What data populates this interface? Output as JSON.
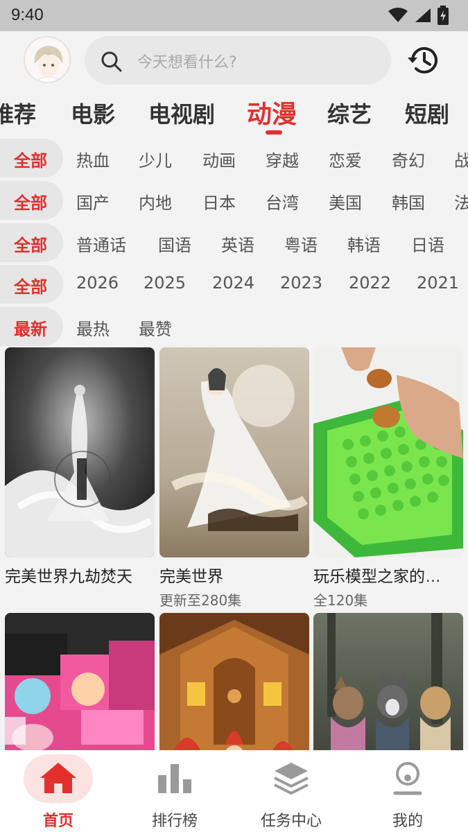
{
  "status_bar": {
    "time": "9:40",
    "icons": [
      "wifi-icon",
      "signal-icon",
      "battery-charging-icon"
    ]
  },
  "header": {
    "avatar": "user-avatar",
    "search_placeholder": "今天想看什么?",
    "history_icon": "history-icon"
  },
  "category_tabs": [
    "推荐",
    "电影",
    "电视剧",
    "动漫",
    "综艺",
    "短剧"
  ],
  "active_category": "动漫",
  "accent_color": "#e3302c",
  "filters": {
    "genre": {
      "active": "全部",
      "options": [
        "热血",
        "少儿",
        "动画",
        "穿越",
        "恋爱",
        "奇幻",
        "战"
      ]
    },
    "region": {
      "active": "全部",
      "options": [
        "国产",
        "内地",
        "日本",
        "台湾",
        "美国",
        "韩国",
        "法"
      ]
    },
    "language": {
      "active": "全部",
      "options": [
        "普通话",
        "国语",
        "英语",
        "粤语",
        "韩语",
        "日语"
      ]
    },
    "year": {
      "active": "全部",
      "options": [
        "2026",
        "2025",
        "2024",
        "2023",
        "2022",
        "2021"
      ]
    },
    "sort": {
      "active": "最新",
      "options": [
        "最热",
        "最赞"
      ]
    }
  },
  "items": [
    {
      "title": "完美世界九劫焚天",
      "subtitle": ""
    },
    {
      "title": "完美世界",
      "subtitle": "更新至280集"
    },
    {
      "title": "玩乐模型之家的…",
      "subtitle": "全120集"
    },
    {
      "title": "",
      "subtitle": ""
    },
    {
      "title": "",
      "subtitle": ""
    },
    {
      "title": "",
      "subtitle": ""
    }
  ],
  "bottom_nav": [
    {
      "label": "首页",
      "icon": "home-icon",
      "active": true
    },
    {
      "label": "排行榜",
      "icon": "bar-chart-icon",
      "active": false
    },
    {
      "label": "任务中心",
      "icon": "layers-icon",
      "active": false
    },
    {
      "label": "我的",
      "icon": "profile-icon",
      "active": false
    }
  ]
}
